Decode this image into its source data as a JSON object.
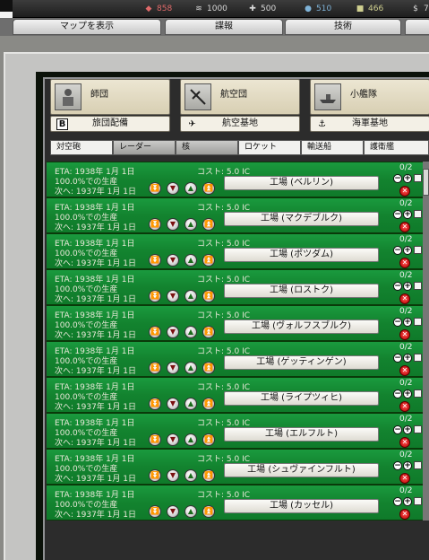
{
  "resources": [
    {
      "icon": "energy-icon",
      "value": "858",
      "color": "#e06a6a"
    },
    {
      "icon": "metal-icon",
      "value": "1000",
      "color": "#d8d8d8"
    },
    {
      "icon": "rare-materials-icon",
      "value": "500",
      "color": "#d8d8d8"
    },
    {
      "icon": "oil-icon",
      "value": "510",
      "color": "#7fb3d8"
    },
    {
      "icon": "supplies-icon",
      "value": "466",
      "color": "#d0d090"
    },
    {
      "icon": "money-icon",
      "value": "7",
      "color": "#d8d8d8"
    }
  ],
  "tabs": [
    "マップを表示",
    "諜報",
    "技術"
  ],
  "categories": [
    {
      "name": "師団",
      "sub": "旅団配備",
      "icon": "infantry-icon",
      "sub_icon": "brigade-icon"
    },
    {
      "name": "航空団",
      "sub": "航空基地",
      "icon": "aircraft-icon",
      "sub_icon": "airbase-icon"
    },
    {
      "name": "小艦隊",
      "sub": "海軍基地",
      "icon": "ship-icon",
      "sub_icon": "anchor-icon"
    }
  ],
  "filters": [
    "対空砲",
    "レーダー",
    "核",
    "ロケット",
    "輸送船",
    "護衛艦"
  ],
  "row_common": {
    "eta": "ETA: 1938年 1月 1日",
    "production": "100.0%での生産",
    "next": "次へ: 1937年 1月 1日",
    "cost": "コスト: 5.0 IC",
    "count": "0/2"
  },
  "queue": [
    {
      "name": "工場 (ベルリン)"
    },
    {
      "name": "工場 (マクデブルク)"
    },
    {
      "name": "工場 (ポツダム)"
    },
    {
      "name": "工場 (ロストク)"
    },
    {
      "name": "工場 (ヴォルフスブルク)"
    },
    {
      "name": "工場 (ゲッティンゲン)"
    },
    {
      "name": "工場 (ライプツィヒ)"
    },
    {
      "name": "工場 (エルフルト)"
    },
    {
      "name": "工場 (シュヴァインフルト)"
    },
    {
      "name": "工場 (カッセル)"
    }
  ]
}
